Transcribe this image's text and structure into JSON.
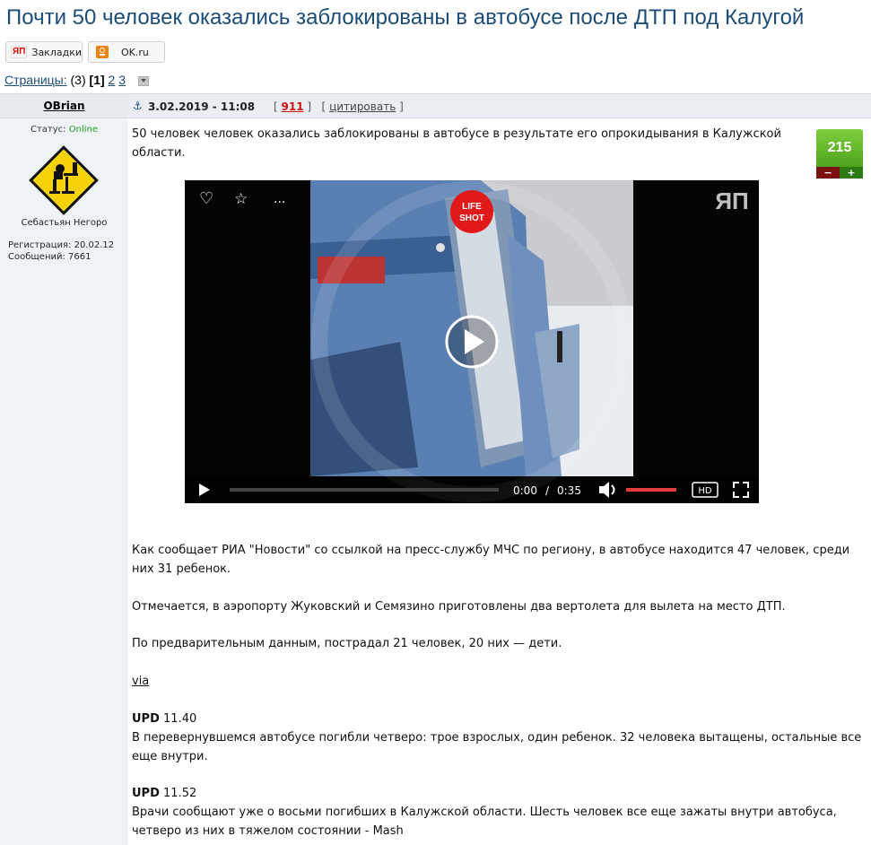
{
  "page": {
    "title": "Почти 50 человек оказались заблокированы в автобусе после ДТП под Калугой"
  },
  "share": {
    "yp_logo": "ЯП",
    "yp_label": "Закладки",
    "ok_label": "OK.ru"
  },
  "pagination": {
    "label": "Страницы:",
    "count": "(3)",
    "current": "[1]",
    "page2": "2",
    "page3": "3"
  },
  "author": {
    "username": "OBrian",
    "status_label": "Статус:",
    "status_value": "Online",
    "title": "Себастьян Негоро",
    "registration": "Регистрация: 20.02.12",
    "messages": "Сообщений: 7661"
  },
  "post": {
    "date": "3.02.2019 - 11:08",
    "rating_open": "[",
    "rating_num": "911",
    "rating_close": "]",
    "cite_open": "[",
    "cite_label": "цитировать",
    "cite_close": "]",
    "intro": "50 человек человек оказались заблокированы в автобусе в результате его опрокидывания в Калужской области.",
    "para1": "Как сообщает РИА \"Новости\" со ссылкой на пресс-службу МЧС по региону, в автобусе находится 47 человек, среди них 31 ребенок.",
    "para2": "Отмечается, в аэропорту Жуковский и Семязино приготовлены два вертолета для вылета на место ДТП.",
    "para3": "По предварительным данным, пострадал 21 человек, 20 них — дети.",
    "via": "via",
    "upd1_label": "UPD",
    "upd1_time": "11.40",
    "upd1_text": "В перевернувшемся автобусе погибли четверо: трое взрослых, один ребенок. 32 человека вытащены, остальные все еще внутри.",
    "upd2_label": "UPD",
    "upd2_time": "11.52",
    "upd2_text": "Врачи сообщают уже о восьми погибших в Калужской области. Шесть человек все еще зажаты внутри автобуса, четверо из них в тяжелом состоянии - Mash"
  },
  "vote": {
    "score": "215",
    "minus": "−",
    "plus": "+"
  },
  "video": {
    "time_current": "0:00",
    "time_sep": "/",
    "time_total": "0:35",
    "hd": "HD",
    "more": "...",
    "watermark": "ЯП",
    "badge_line1": "LIFE",
    "badge_line2": "SHOT",
    "volume_level": 1.0,
    "progress": 0.0
  }
}
